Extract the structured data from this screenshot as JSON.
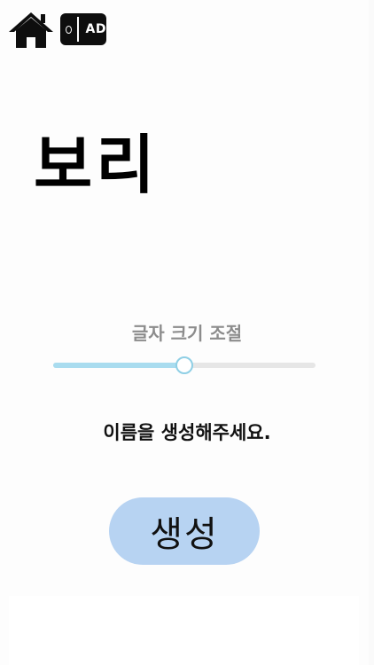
{
  "header": {
    "home_icon": "home-icon",
    "ad_badge": "AD"
  },
  "main": {
    "name": "보리",
    "font_size_label": "글자 크기 조절",
    "font_size_slider": {
      "value": 0.5,
      "min": 0,
      "max": 1
    },
    "prompt": "이름을 생성해주세요.",
    "generate_button": "생성"
  },
  "colors": {
    "slider_fill": "#a9dcef",
    "slider_track": "#e6e6e6",
    "button_bg": "#b7d3f2"
  }
}
